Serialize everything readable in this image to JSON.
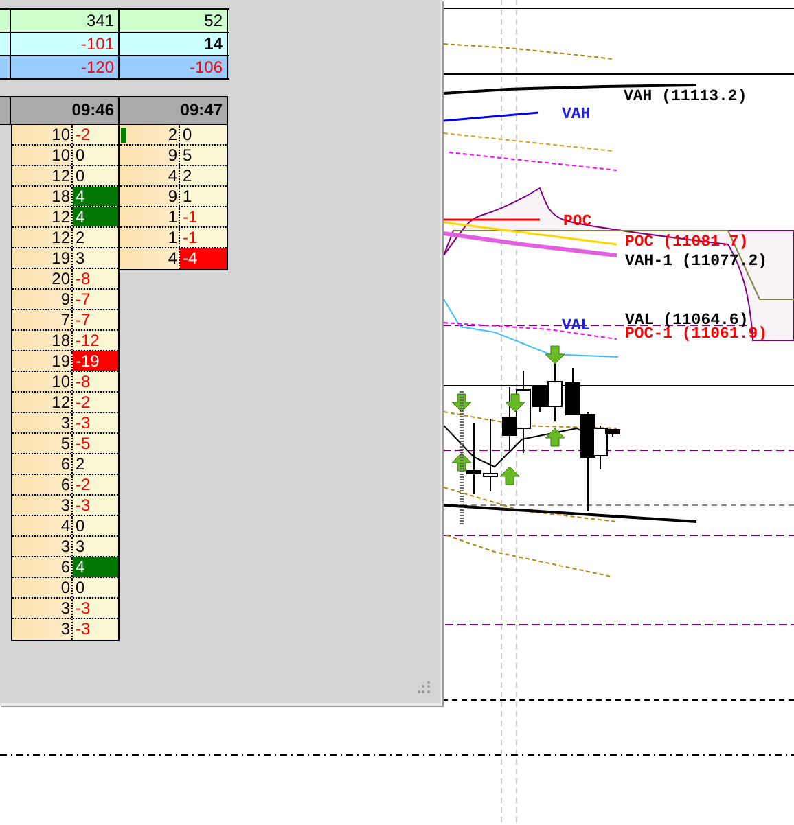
{
  "summary_rows": [
    {
      "color": "#ccffcc",
      "cells": [
        {
          "text": "341",
          "negative": false,
          "bold": false
        },
        {
          "text": "52",
          "negative": false,
          "bold": false
        }
      ]
    },
    {
      "color": "#ccffff",
      "cells": [
        {
          "text": "-101",
          "negative": true,
          "bold": false
        },
        {
          "text": "14",
          "negative": false,
          "bold": true
        }
      ]
    },
    {
      "color": "#99ccff",
      "cells": [
        {
          "text": "-120",
          "negative": true,
          "bold": false
        },
        {
          "text": "-106",
          "negative": true,
          "bold": false
        }
      ]
    }
  ],
  "columns": [
    {
      "time": "09:46",
      "rows": [
        {
          "volume": "10",
          "delta": "-2",
          "negative": true,
          "marker": false
        },
        {
          "volume": "10",
          "delta": "0",
          "negative": false,
          "marker": false
        },
        {
          "volume": "12",
          "delta": "0",
          "negative": false,
          "marker": false
        },
        {
          "volume": "18",
          "delta": "4",
          "color": "#007700",
          "marker": false
        },
        {
          "volume": "12",
          "delta": "4",
          "color": "#007700",
          "marker": false
        },
        {
          "volume": "12",
          "delta": "2",
          "negative": false,
          "marker": false
        },
        {
          "volume": "19",
          "delta": "3",
          "negative": false,
          "marker": false
        },
        {
          "volume": "20",
          "delta": "-8",
          "negative": true,
          "marker": false
        },
        {
          "volume": "9",
          "delta": "-7",
          "negative": true,
          "marker": false
        },
        {
          "volume": "7",
          "delta": "-7",
          "negative": true,
          "marker": false
        },
        {
          "volume": "18",
          "delta": "-12",
          "negative": true,
          "marker": false
        },
        {
          "volume": "19",
          "delta": "-19",
          "color": "#ff0000",
          "marker": false
        },
        {
          "volume": "10",
          "delta": "-8",
          "negative": true,
          "marker": false
        },
        {
          "volume": "12",
          "delta": "-2",
          "negative": true,
          "marker": false
        },
        {
          "volume": "3",
          "delta": "-3",
          "negative": true,
          "marker": false
        },
        {
          "volume": "5",
          "delta": "-5",
          "negative": true,
          "marker": false
        },
        {
          "volume": "6",
          "delta": "2",
          "negative": false,
          "marker": false
        },
        {
          "volume": "6",
          "delta": "-2",
          "negative": true,
          "marker": false
        },
        {
          "volume": "3",
          "delta": "-3",
          "negative": true,
          "marker": false
        },
        {
          "volume": "4",
          "delta": "0",
          "negative": false,
          "marker": false
        },
        {
          "volume": "3",
          "delta": "3",
          "negative": false,
          "marker": false
        },
        {
          "volume": "6",
          "delta": "4",
          "color": "#007700",
          "marker": false
        },
        {
          "volume": "0",
          "delta": "0",
          "negative": false,
          "marker": false
        },
        {
          "volume": "3",
          "delta": "-3",
          "negative": true,
          "marker": false
        },
        {
          "volume": "3",
          "delta": "-3",
          "negative": true,
          "marker": false
        }
      ]
    },
    {
      "time": "09:47",
      "rows": [
        {
          "volume": "2",
          "delta": "0",
          "negative": false,
          "marker": true
        },
        {
          "volume": "9",
          "delta": "5",
          "negative": false,
          "marker": false
        },
        {
          "volume": "4",
          "delta": "2",
          "negative": false,
          "marker": false
        },
        {
          "volume": "9",
          "delta": "1",
          "negative": false,
          "marker": false
        },
        {
          "volume": "1",
          "delta": "-1",
          "negative": true,
          "marker": false
        },
        {
          "volume": "1",
          "delta": "-1",
          "negative": true,
          "marker": false
        },
        {
          "volume": "4",
          "delta": "-4",
          "color": "#ff0000",
          "marker": false
        }
      ]
    }
  ],
  "chart_labels": [
    {
      "text": "VAH (11113.2)",
      "color": "#000000"
    },
    {
      "text": "VAH",
      "color": "#2020e0"
    },
    {
      "text": "POC",
      "color": "#ff0000"
    },
    {
      "text": "POC (11081.7)",
      "color": "#ff0000"
    },
    {
      "text": "VAH-1 (11077.2)",
      "color": "#000000"
    },
    {
      "text": "VAL",
      "color": "#2020e0"
    },
    {
      "text": "VAL (11064.6)",
      "color": "#000000"
    },
    {
      "text": "POC-1 (11061.9)",
      "color": "#ff0000"
    }
  ]
}
